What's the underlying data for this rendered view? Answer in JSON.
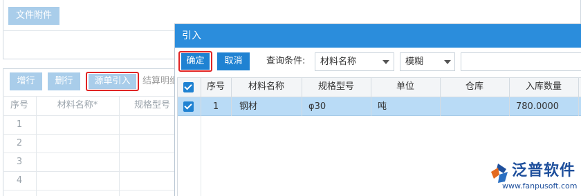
{
  "background": {
    "attachment_button": "文件附件",
    "toolbar": {
      "add_row": "增行",
      "delete_row": "删行",
      "import_source": "源单引入",
      "settlement": "结算明细"
    },
    "table": {
      "headers": [
        "序号",
        "材料名称*",
        "规格型号"
      ],
      "rows": [
        "1",
        "2",
        "3",
        "4"
      ]
    }
  },
  "dialog": {
    "title": "引入",
    "confirm_label": "确定",
    "cancel_label": "取消",
    "query_label": "查询条件:",
    "field_select": "材料名称",
    "match_select": "模糊",
    "search_value": "",
    "table": {
      "headers": [
        "序号",
        "材料名称",
        "规格型号",
        "单位",
        "仓库",
        "入库数量"
      ],
      "rows": [
        {
          "index": "1",
          "name": "钢材",
          "spec": "φ30",
          "unit": "吨",
          "warehouse": "",
          "quantity": "780.0000",
          "checked": true
        }
      ]
    }
  },
  "watermark": {
    "brand": "泛普软件",
    "url": "www.fanpusoft.com"
  },
  "colors": {
    "dialog_header": "#2b8ddc",
    "primary_button": "#1f82d2",
    "light_button": "#a9cdea",
    "selected_row": "#b9dbf6",
    "highlight_border": "#e02424"
  }
}
